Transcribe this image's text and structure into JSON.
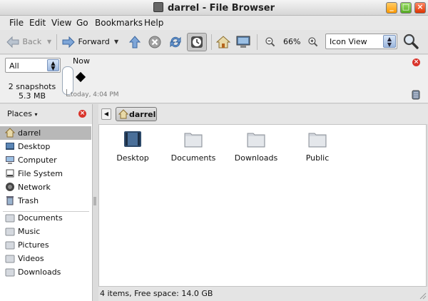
{
  "window": {
    "title": "darrel - File Browser"
  },
  "menu": [
    "File",
    "Edit",
    "View",
    "Go",
    "Bookmarks",
    "Help"
  ],
  "toolbar": {
    "back_label": "Back",
    "forward_label": "Forward",
    "zoom_level": "66%",
    "view_mode": "Icon View"
  },
  "snapshots": {
    "filter_value": "All",
    "count_label": "2 snapshots",
    "size_label": "5.3 MB",
    "now_label": "Now",
    "timestamp_label": "today, 4:04 PM"
  },
  "sidebar": {
    "header": "Places",
    "items": [
      {
        "label": "darrel",
        "icon": "home-icon"
      },
      {
        "label": "Desktop",
        "icon": "desktop-icon"
      },
      {
        "label": "Computer",
        "icon": "computer-icon"
      },
      {
        "label": "File System",
        "icon": "drive-icon"
      },
      {
        "label": "Network",
        "icon": "network-icon"
      },
      {
        "label": "Trash",
        "icon": "trash-icon"
      }
    ],
    "bookmarks": [
      {
        "label": "Documents",
        "icon": "folder-icon"
      },
      {
        "label": "Music",
        "icon": "folder-icon"
      },
      {
        "label": "Pictures",
        "icon": "folder-icon"
      },
      {
        "label": "Videos",
        "icon": "folder-icon"
      },
      {
        "label": "Downloads",
        "icon": "folder-icon"
      }
    ]
  },
  "pathbar": {
    "current": "darrel"
  },
  "files": [
    {
      "label": "Desktop",
      "icon": "desktop-folder-icon"
    },
    {
      "label": "Documents",
      "icon": "folder-icon"
    },
    {
      "label": "Downloads",
      "icon": "folder-icon"
    },
    {
      "label": "Public",
      "icon": "folder-icon"
    }
  ],
  "status": {
    "text": "4 items, Free space: 14.0 GB"
  },
  "colors": {
    "selection": "#b8b8b8",
    "accent": "#3a7bd5",
    "close_red": "#d9342b"
  }
}
